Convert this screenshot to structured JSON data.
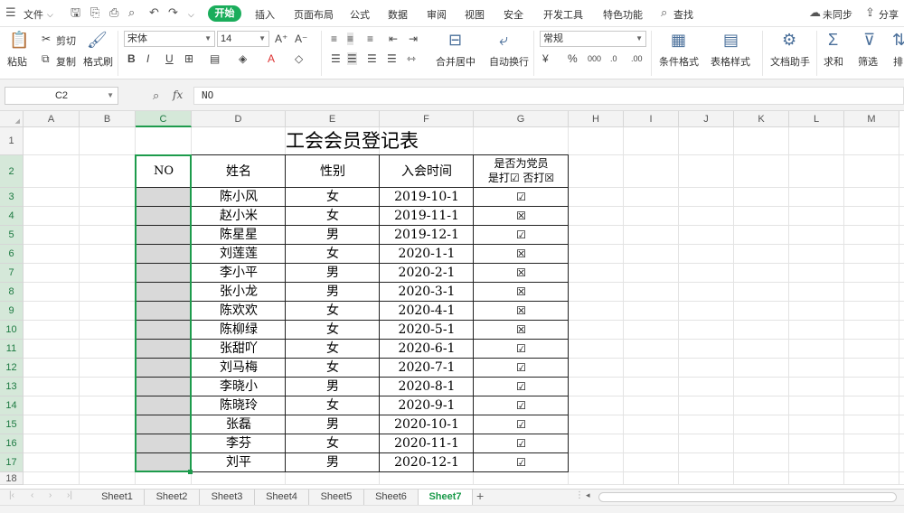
{
  "menubar": {
    "file": "文件",
    "tabs": [
      "开始",
      "插入",
      "页面布局",
      "公式",
      "数据",
      "审阅",
      "视图",
      "安全",
      "开发工具",
      "特色功能"
    ],
    "search": "查找",
    "sync": "未同步",
    "share": "分享"
  },
  "ribbon": {
    "paste": "粘贴",
    "cut": "剪切",
    "copy": "复制",
    "format_painter": "格式刷",
    "font_name": "宋体",
    "font_size": "14",
    "merge_center": "合并居中",
    "wrap_text": "自动换行",
    "number_format": "常规",
    "conditional_format": "条件格式",
    "table_style": "表格样式",
    "doc_helper": "文档助手",
    "sum": "求和",
    "filter": "筛选",
    "sort": "排"
  },
  "formula": {
    "name_box": "C2",
    "fx": "fx",
    "value": "NO"
  },
  "columns": [
    "A",
    "B",
    "C",
    "D",
    "E",
    "F",
    "G",
    "H",
    "I",
    "J",
    "K",
    "L",
    "M"
  ],
  "rows": [
    "1",
    "2",
    "3",
    "4",
    "5",
    "6",
    "7",
    "8",
    "9",
    "10",
    "11",
    "12",
    "13",
    "14",
    "15",
    "16",
    "17",
    "18"
  ],
  "sheet": {
    "title": "工会会员登记表",
    "headers": {
      "no": "NO",
      "name": "姓名",
      "gender": "性别",
      "join_date": "入会时间",
      "party_line1": "是否为党员",
      "party_line2": "是打☑  否打☒"
    },
    "records": [
      {
        "name": "陈小风",
        "gender": "女",
        "date": "2019-10-1",
        "party": "☑"
      },
      {
        "name": "赵小米",
        "gender": "女",
        "date": "2019-11-1",
        "party": "☒"
      },
      {
        "name": "陈星星",
        "gender": "男",
        "date": "2019-12-1",
        "party": "☑"
      },
      {
        "name": "刘莲莲",
        "gender": "女",
        "date": "2020-1-1",
        "party": "☒"
      },
      {
        "name": "李小平",
        "gender": "男",
        "date": "2020-2-1",
        "party": "☒"
      },
      {
        "name": "张小龙",
        "gender": "男",
        "date": "2020-3-1",
        "party": "☒"
      },
      {
        "name": "陈欢欢",
        "gender": "女",
        "date": "2020-4-1",
        "party": "☒"
      },
      {
        "name": "陈柳绿",
        "gender": "女",
        "date": "2020-5-1",
        "party": "☒"
      },
      {
        "name": "张甜吖",
        "gender": "女",
        "date": "2020-6-1",
        "party": "☑"
      },
      {
        "name": "刘马梅",
        "gender": "女",
        "date": "2020-7-1",
        "party": "☑"
      },
      {
        "name": "李晓小",
        "gender": "男",
        "date": "2020-8-1",
        "party": "☑"
      },
      {
        "name": "陈晓玲",
        "gender": "女",
        "date": "2020-9-1",
        "party": "☑"
      },
      {
        "name": "张磊",
        "gender": "男",
        "date": "2020-10-1",
        "party": "☑"
      },
      {
        "name": "李芬",
        "gender": "女",
        "date": "2020-11-1",
        "party": "☑"
      },
      {
        "name": "刘平",
        "gender": "男",
        "date": "2020-12-1",
        "party": "☑"
      }
    ]
  },
  "sheet_tabs": [
    "Sheet1",
    "Sheet2",
    "Sheet3",
    "Sheet4",
    "Sheet5",
    "Sheet6",
    "Sheet7"
  ],
  "active_sheet": "Sheet7",
  "colors": {
    "accent": "#1aad5b",
    "selection": "#1d9b4c",
    "selected_fill": "#d9d9d9"
  }
}
